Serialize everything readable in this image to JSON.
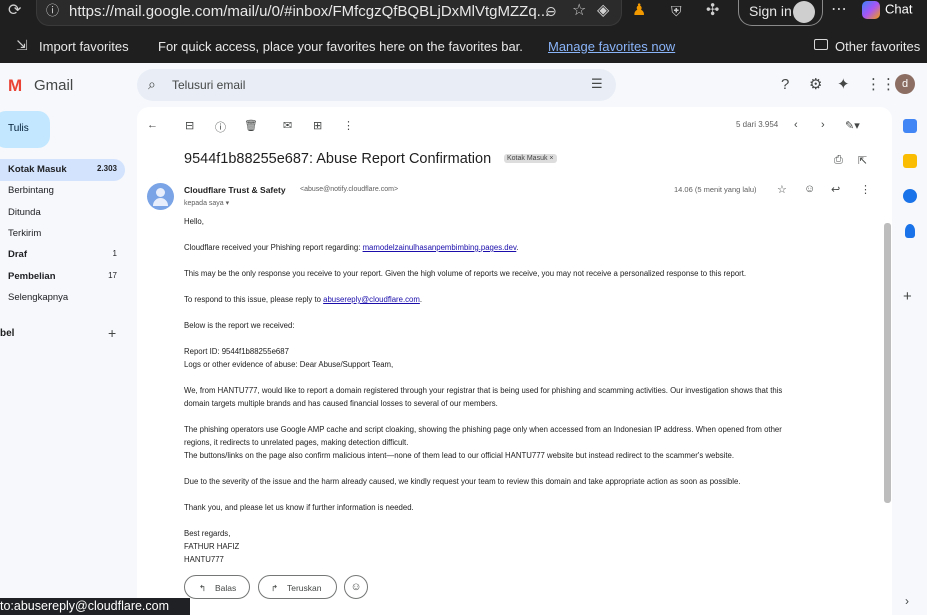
{
  "browser": {
    "url": "https://mail.google.com/mail/u/0/#inbox/FMfcgzQfBQBLjDxMlVtgMZZq...",
    "signin_label": "Sign in",
    "chat_label": "Chat"
  },
  "favorites_bar": {
    "import_label": "Import favorites",
    "message": "For quick access, place your favorites here on the favorites bar.",
    "manage_link": "Manage favorites now",
    "other_label": "Other favorites"
  },
  "gmail": {
    "app_name": "Gmail",
    "search_placeholder": "Telusuri email",
    "user_initial": "d",
    "compose_label": "Tulis",
    "nav": [
      {
        "label": "Kotak Masuk",
        "count": "2.303"
      },
      {
        "label": "Berbintang",
        "count": ""
      },
      {
        "label": "Ditunda",
        "count": ""
      },
      {
        "label": "Terkirim",
        "count": ""
      },
      {
        "label": "Draf",
        "count": "1"
      },
      {
        "label": "Pembelian",
        "count": "17"
      },
      {
        "label": "Selengkapnya",
        "count": ""
      }
    ],
    "labels_heading": "bel",
    "pagination": "5 dari 3.954"
  },
  "email": {
    "subject": "9544f1b88255e687: Abuse Report Confirmation",
    "label_chip": "Kotak Masuk ×",
    "sender_name": "Cloudflare Trust & Safety",
    "sender_email": "<abuse@notify.cloudflare.com>",
    "to": "kepada saya",
    "time": "14.06 (5 menit yang lalu)",
    "greeting": "Hello,",
    "p1_prefix": "Cloudflare received your Phishing report regarding: ",
    "p1_link": "mamodelzainulhasanpembimbing.pages.dev",
    "p1_suffix": ".",
    "p2": "This may be the only response you receive to your report. Given the high volume of reports we receive, you may not receive a personalized response to this report.",
    "p3_prefix": "To respond to this issue, please reply to ",
    "p3_link": "abusereply@cloudflare.com",
    "p3_suffix": ".",
    "p4": "Below is the report we received:",
    "report_id": "Report ID: 9544f1b88255e687",
    "logs": "Logs or other evidence of abuse:  Dear Abuse/Support Team,",
    "p5a": "We, from HANTU777, would like to report a domain registered through your registrar that is being used for phishing and scamming activities. Our investigation shows that this",
    "p5b": "domain targets multiple brands and has caused financial losses to several of our members.",
    "p6a": "The phishing operators use Google AMP cache and script cloaking, showing the phishing page only when accessed from an Indonesian IP address. When opened from other",
    "p6b": "regions, it redirects to unrelated pages, making detection difficult.",
    "p6c": "The buttons/links on the page also confirm malicious intent—none of them lead to our official HANTU777 website but instead redirect to the scammer's website.",
    "p7": "Due to the severity of the issue and the harm already caused, we kindly request your team to review this domain and take appropriate action as soon as possible.",
    "p8": "Thank you, and please let us know if further information is needed.",
    "sig1": "Best regards,",
    "sig2": "FATHUR HAFIZ",
    "sig3": "HANTU777",
    "reply_label": "Balas",
    "forward_label": "Teruskan"
  },
  "status_tip": "to:abusereply@cloudflare.com"
}
